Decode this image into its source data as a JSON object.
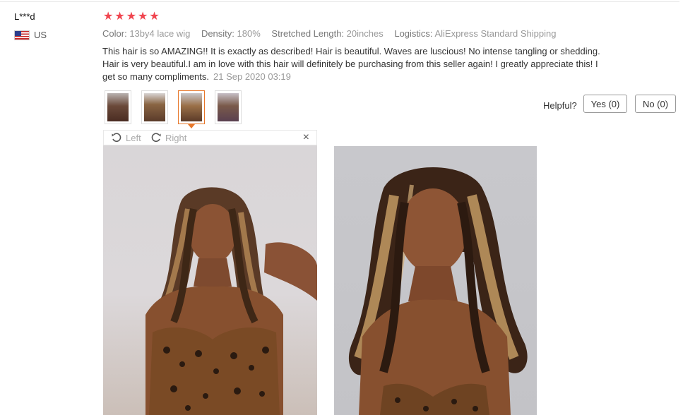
{
  "review": {
    "user": "L***d",
    "country": "US",
    "stars": [
      "★",
      "★",
      "★",
      "★",
      "★"
    ],
    "specs": [
      {
        "label": "Color:",
        "value": "13by4 lace wig"
      },
      {
        "label": "Density:",
        "value": "180%"
      },
      {
        "label": "Stretched Length:",
        "value": "20inches"
      },
      {
        "label": "Logistics:",
        "value": "AliExpress Standard Shipping"
      }
    ],
    "text": "This hair is so AMAZING!! It is exactly as described! Hair is beautiful. Waves are luscious! No intense tangling or shedding. Hair is very beautiful.I am in love with this hair  will definitely be purchasing from this seller again! I greatly appreciate this! I get so many compliments.",
    "date": "21 Sep 2020 03:19"
  },
  "helpful": {
    "label": "Helpful?",
    "yes": "Yes (0)",
    "no": "No (0)"
  },
  "viewer": {
    "rotate_left": "Left",
    "rotate_right": "Right",
    "close": "×"
  },
  "colors": {
    "star": "#f0454f",
    "active_thumb": "#e7772a"
  }
}
